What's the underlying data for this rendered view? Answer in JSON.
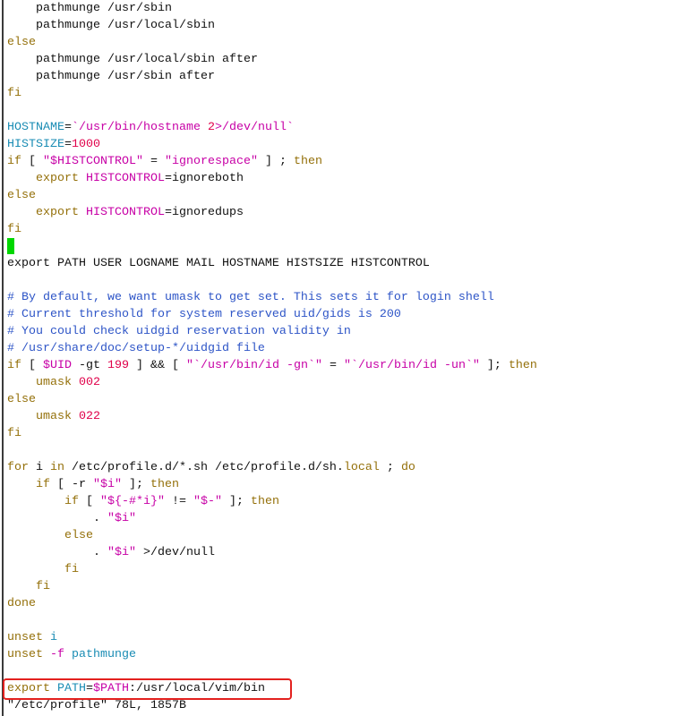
{
  "editor": {
    "lines": [
      [
        {
          "text": "    pathmunge /usr/sbin"
        }
      ],
      [
        {
          "text": "    pathmunge /usr/local/sbin"
        }
      ],
      [
        {
          "text": "else",
          "color": "#94700a"
        }
      ],
      [
        {
          "text": "    pathmunge /usr/local/sbin after"
        }
      ],
      [
        {
          "text": "    pathmunge /usr/sbin after"
        }
      ],
      [
        {
          "text": "fi",
          "color": "#94700a"
        }
      ],
      [],
      [
        {
          "text": "HOSTNAME",
          "color": "#1a8cb4"
        },
        {
          "text": "="
        },
        {
          "text": "`/usr/bin/hostname ",
          "color": "#c700a6"
        },
        {
          "text": "2",
          "color": "#e0004a"
        },
        {
          "text": ">/dev/null`",
          "color": "#c700a6"
        }
      ],
      [
        {
          "text": "HISTSIZE",
          "color": "#1a8cb4"
        },
        {
          "text": "="
        },
        {
          "text": "1000",
          "color": "#e0004a"
        }
      ],
      [
        {
          "text": "if",
          "color": "#94700a"
        },
        {
          "text": " [ "
        },
        {
          "text": "\"$HISTCONTROL\"",
          "color": "#c700a6"
        },
        {
          "text": " = "
        },
        {
          "text": "\"ignorespace\"",
          "color": "#c700a6"
        },
        {
          "text": " ] ; "
        },
        {
          "text": "then",
          "color": "#94700a"
        }
      ],
      [
        {
          "text": "    "
        },
        {
          "text": "export",
          "color": "#94700a"
        },
        {
          "text": " "
        },
        {
          "text": "HISTCONTROL",
          "color": "#c700a6"
        },
        {
          "text": "=ignoreboth"
        }
      ],
      [
        {
          "text": "else",
          "color": "#94700a"
        }
      ],
      [
        {
          "text": "    "
        },
        {
          "text": "export",
          "color": "#94700a"
        },
        {
          "text": " "
        },
        {
          "text": "HISTCONTROL",
          "color": "#c700a6"
        },
        {
          "text": "=ignoredups"
        }
      ],
      [
        {
          "text": "fi",
          "color": "#94700a"
        }
      ],
      [],
      [
        {
          "text": "export PATH USER LOGNAME MAIL HOSTNAME HISTSIZE HISTCONTROL"
        }
      ],
      [],
      [
        {
          "text": "# By default, we want umask to get set. This sets it for login shell",
          "color": "#2e55c7"
        }
      ],
      [
        {
          "text": "# Current threshold for system reserved uid/gids is 200",
          "color": "#2e55c7"
        }
      ],
      [
        {
          "text": "# You could check uidgid reservation validity in",
          "color": "#2e55c7"
        }
      ],
      [
        {
          "text": "# /usr/share/doc/setup-*/uidgid file",
          "color": "#2e55c7"
        }
      ],
      [
        {
          "text": "if",
          "color": "#94700a"
        },
        {
          "text": " [ "
        },
        {
          "text": "$UID",
          "color": "#c700a6"
        },
        {
          "text": " -gt "
        },
        {
          "text": "199",
          "color": "#e0004a"
        },
        {
          "text": " ] && [ "
        },
        {
          "text": "\"`/usr/bin/id -gn`\"",
          "color": "#c700a6"
        },
        {
          "text": " = "
        },
        {
          "text": "\"`/usr/bin/id -un`\"",
          "color": "#c700a6"
        },
        {
          "text": " ]; "
        },
        {
          "text": "then",
          "color": "#94700a"
        }
      ],
      [
        {
          "text": "    "
        },
        {
          "text": "umask",
          "color": "#94700a"
        },
        {
          "text": " "
        },
        {
          "text": "002",
          "color": "#e0004a"
        }
      ],
      [
        {
          "text": "else",
          "color": "#94700a"
        }
      ],
      [
        {
          "text": "    "
        },
        {
          "text": "umask",
          "color": "#94700a"
        },
        {
          "text": " "
        },
        {
          "text": "022",
          "color": "#e0004a"
        }
      ],
      [
        {
          "text": "fi",
          "color": "#94700a"
        }
      ],
      [],
      [
        {
          "text": "for",
          "color": "#94700a"
        },
        {
          "text": " i "
        },
        {
          "text": "in",
          "color": "#94700a"
        },
        {
          "text": " /etc/profile.d/*.sh /etc/profile.d/sh."
        },
        {
          "text": "local",
          "color": "#94700a"
        },
        {
          "text": " ; "
        },
        {
          "text": "do",
          "color": "#94700a"
        }
      ],
      [
        {
          "text": "    "
        },
        {
          "text": "if",
          "color": "#94700a"
        },
        {
          "text": " [ -r "
        },
        {
          "text": "\"$i\"",
          "color": "#c700a6"
        },
        {
          "text": " ]; "
        },
        {
          "text": "then",
          "color": "#94700a"
        }
      ],
      [
        {
          "text": "        "
        },
        {
          "text": "if",
          "color": "#94700a"
        },
        {
          "text": " [ "
        },
        {
          "text": "\"${-#*i}\"",
          "color": "#c700a6"
        },
        {
          "text": " != "
        },
        {
          "text": "\"$-\"",
          "color": "#c700a6"
        },
        {
          "text": " ]; "
        },
        {
          "text": "then",
          "color": "#94700a"
        }
      ],
      [
        {
          "text": "            . "
        },
        {
          "text": "\"$i\"",
          "color": "#c700a6"
        }
      ],
      [
        {
          "text": "        "
        },
        {
          "text": "else",
          "color": "#94700a"
        }
      ],
      [
        {
          "text": "            . "
        },
        {
          "text": "\"$i\"",
          "color": "#c700a6"
        },
        {
          "text": " >/dev/null"
        }
      ],
      [
        {
          "text": "        "
        },
        {
          "text": "fi",
          "color": "#94700a"
        }
      ],
      [
        {
          "text": "    "
        },
        {
          "text": "fi",
          "color": "#94700a"
        }
      ],
      [
        {
          "text": "done",
          "color": "#94700a"
        }
      ],
      [],
      [
        {
          "text": "unset",
          "color": "#94700a"
        },
        {
          "text": " "
        },
        {
          "text": "i",
          "color": "#1a8cb4"
        }
      ],
      [
        {
          "text": "unset",
          "color": "#94700a"
        },
        {
          "text": " "
        },
        {
          "text": "-f",
          "color": "#c700a6"
        },
        {
          "text": " "
        },
        {
          "text": "pathmunge",
          "color": "#1a8cb4"
        }
      ],
      [],
      [
        {
          "text": "export",
          "color": "#94700a"
        },
        {
          "text": " "
        },
        {
          "text": "PATH",
          "color": "#1a8cb4"
        },
        {
          "text": "="
        },
        {
          "text": "$PATH",
          "color": "#c700a6"
        },
        {
          "text": ":/usr/local/vim/bin"
        }
      ]
    ]
  },
  "status": {
    "text": "\"/etc/profile\" 78L, 1857B"
  },
  "cursor": {
    "color": "#00d700"
  },
  "highlight": {
    "color": "#e3211f"
  }
}
